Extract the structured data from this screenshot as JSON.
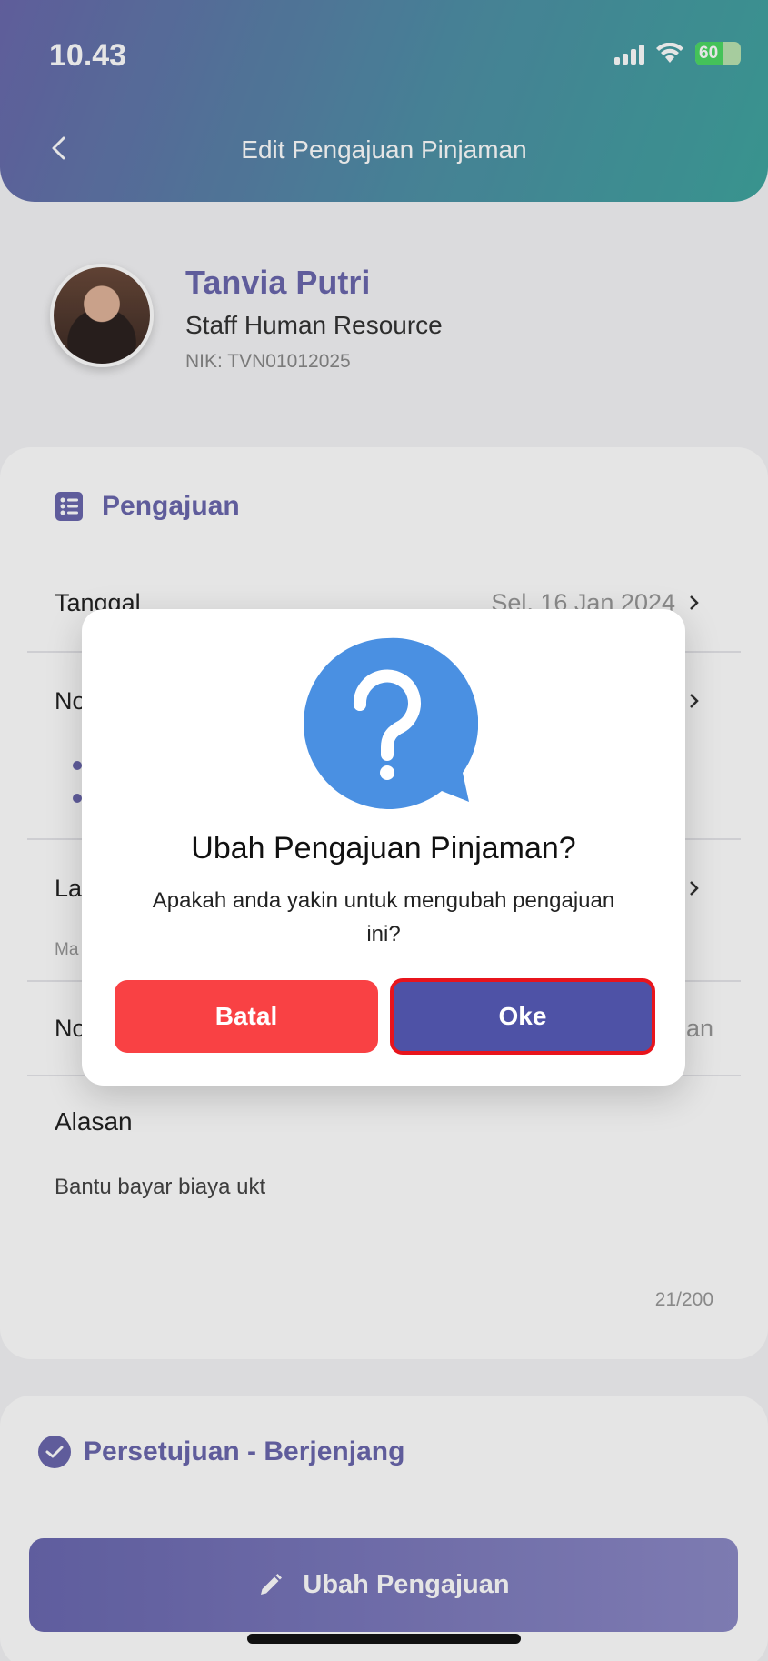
{
  "status_bar": {
    "time": "10.43",
    "battery": "60"
  },
  "header": {
    "title": "Edit  Pengajuan Pinjaman"
  },
  "profile": {
    "name": "Tanvia Putri",
    "role": "Staff Human Resource",
    "nik": "NIK: TVN01012025"
  },
  "section": {
    "title": "Pengajuan",
    "rows": [
      {
        "label": "Tanggal",
        "value": "Sel, 16 Jan 2024"
      },
      {
        "label": "No",
        "value": ""
      },
      {
        "label": "La",
        "sublabel": "Ma"
      },
      {
        "label": "No",
        "value": "an"
      }
    ],
    "reason_label": "Alasan",
    "reason_text": "Bantu bayar biaya ukt",
    "counter": "21/200"
  },
  "approval": {
    "title": "Persetujuan - Berjenjang"
  },
  "bottom_button": {
    "label": "Ubah Pengajuan"
  },
  "dialog": {
    "title": "Ubah Pengajuan Pinjaman?",
    "message": "Apakah anda yakin untuk mengubah pengajuan ini?",
    "cancel_label": "Batal",
    "ok_label": "Oke",
    "icon": "question-bubble-icon"
  },
  "colors": {
    "accent": "#6a67ad",
    "cancel": "#f94144",
    "ok": "#4e52a6",
    "highlight": "#e8141c",
    "dialog_icon": "#4a90e2"
  }
}
